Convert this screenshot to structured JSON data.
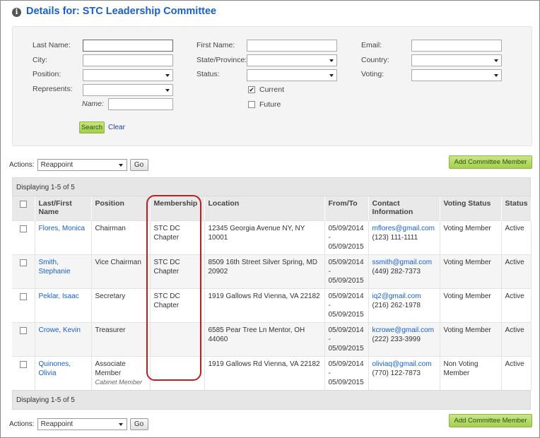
{
  "header": {
    "title": "Details for: STC Leadership Committee",
    "icon": "info-icon"
  },
  "search": {
    "last_name_label": "Last Name:",
    "first_name_label": "First Name:",
    "email_label": "Email:",
    "city_label": "City:",
    "state_label": "State/Province:",
    "country_label": "Country:",
    "position_label": "Position:",
    "status_label": "Status:",
    "voting_label": "Voting:",
    "represents_label": "Represents:",
    "name_label": "Name:",
    "current_label": "Current",
    "future_label": "Future",
    "current_checked": true,
    "future_checked": false,
    "search_button": "Search",
    "clear_link": "Clear"
  },
  "actions": {
    "label": "Actions:",
    "selected": "Reappoint",
    "go_button": "Go",
    "add_button": "Add Committee Member"
  },
  "results": {
    "display_text": "Displaying 1-5 of 5",
    "columns": [
      "Last/First Name",
      "Position",
      "Membership",
      "Location",
      "From/To",
      "Contact Information",
      "Voting Status",
      "Status"
    ],
    "rows": [
      {
        "name": "Flores, Monica",
        "position": "Chairman",
        "sub_role": "",
        "membership": "STC DC Chapter",
        "location": "12345 Georgia Avenue NY, NY 10001",
        "from": "05/09/2014",
        "sep": "-",
        "to": "05/09/2015",
        "email": "mflores@gmail.com",
        "phone": "(123) 111-1111",
        "voting": "Voting Member",
        "status": "Active"
      },
      {
        "name": "Smith, Stephanie",
        "position": "Vice Chairman",
        "sub_role": "",
        "membership": "STC DC Chapter",
        "location": "8509 16th Street Silver Spring, MD 20902",
        "from": "05/09/2014",
        "sep": "-",
        "to": "05/09/2015",
        "email": "ssmith@gmail.com",
        "phone": "(449) 282-7373",
        "voting": "Voting Member",
        "status": "Active"
      },
      {
        "name": "Peklar, Isaac",
        "position": "Secretary",
        "sub_role": "",
        "membership": "STC DC Chapter",
        "location": "1919 Gallows Rd Vienna, VA 22182",
        "from": "05/09/2014",
        "sep": "-",
        "to": "05/09/2015",
        "email": "iq2@gmail.com",
        "phone": "(216) 262-1978",
        "voting": "Voting Member",
        "status": "Active"
      },
      {
        "name": "Crowe, Kevin",
        "position": "Treasurer",
        "sub_role": "",
        "membership": "",
        "location": "6585 Pear Tree Ln Mentor, OH 44060",
        "from": "05/09/2014",
        "sep": "-",
        "to": "05/09/2015",
        "email": "kcrowe@gmail.com",
        "phone": "(222) 233-3999",
        "voting": "Voting Member",
        "status": "Active"
      },
      {
        "name": "Quinones, Olivia",
        "position": "Associate Member",
        "sub_role": "Cabinet Member",
        "membership": "",
        "location": "1919 Gallows Rd Vienna, VA 22182",
        "from": "05/09/2014",
        "sep": "-",
        "to": "05/09/2015",
        "email": "oliviaq@gmail.com",
        "phone": "(770) 122-7873",
        "voting": "Non Voting Member",
        "status": "Active"
      }
    ]
  },
  "colors": {
    "link": "#1a5fc6",
    "button_green": "#a6cf4e",
    "highlight": "#c51b1b"
  }
}
